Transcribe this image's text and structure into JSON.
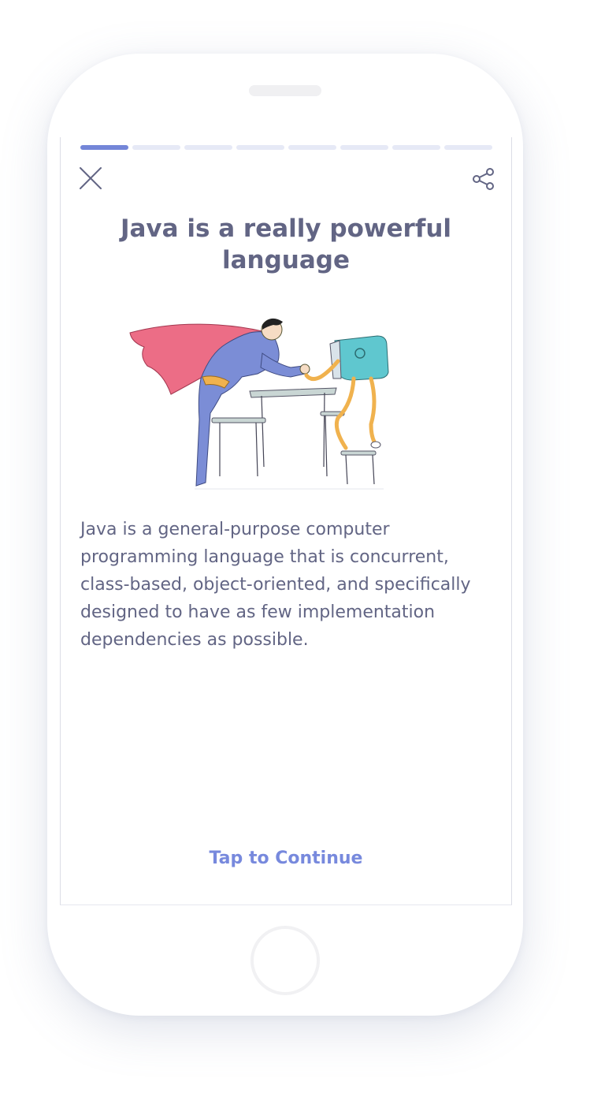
{
  "lesson": {
    "progress": {
      "total_steps": 8,
      "current_step": 1
    },
    "title": "Java is a really powerful language",
    "body": "Java is a general-purpose computer programming language that is concurrent, class-based, object-oriented, and specifically designed to have as few implementation dependencies as possible.",
    "cta_label": "Tap to Continue",
    "illustration": "superhero-arm-wrestling-computer"
  },
  "icons": {
    "close": "close-icon",
    "share": "share-icon"
  },
  "colors": {
    "accent": "#7486d8",
    "progress_track": "#e6e9f6",
    "text": "#626584",
    "cta": "#7789dd"
  }
}
